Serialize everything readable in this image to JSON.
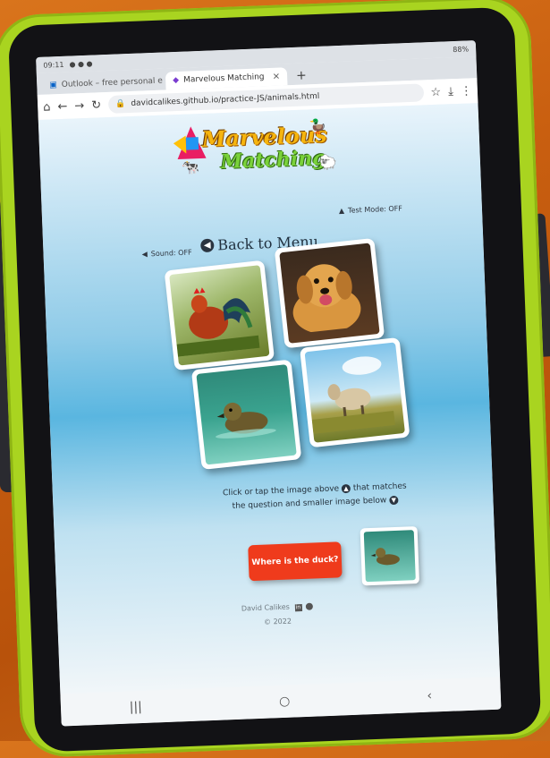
{
  "browser": {
    "status_time": "09:11",
    "battery": "88%",
    "tabs": [
      {
        "label": "Outlook – free personal e"
      },
      {
        "label": "Marvelous Matching"
      }
    ],
    "url": "davidcalikes.github.io/practice-JS/animals.html"
  },
  "logo": {
    "line1": "Marvelous",
    "line2": "Matching"
  },
  "controls": {
    "sound_label": "Sound: OFF",
    "test_mode_label": "Test Mode: OFF",
    "back_label": "Back to Menu"
  },
  "cards": [
    {
      "animal": "rooster"
    },
    {
      "animal": "golden retriever"
    },
    {
      "animal": "duckling"
    },
    {
      "animal": "sheep"
    }
  ],
  "instructions": {
    "line1a": "Click or tap the image above",
    "line1b": "that matches",
    "line2": "the question and smaller image below"
  },
  "question_button": "Where is the duck?",
  "footer": {
    "author": "David Calikes",
    "copyright": "© 2022"
  },
  "colors": {
    "tablet_case": "#a9d420",
    "question_button": "#ef3b1c"
  }
}
